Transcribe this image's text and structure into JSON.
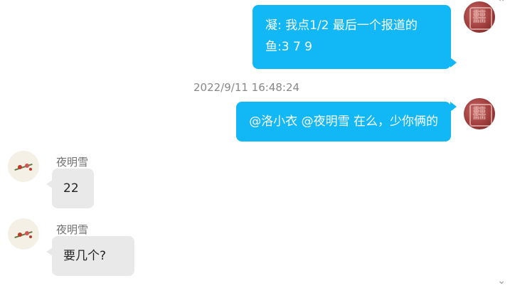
{
  "messages": [
    {
      "side": "out",
      "line1": "凝:  我点1/2  最后一个报道的",
      "line2": "鱼:3 7 9"
    },
    {
      "timestamp": "2022/9/11 16:48:24"
    },
    {
      "side": "out",
      "text": "@洛小衣 @夜明雪 在么，少你俩的"
    },
    {
      "side": "in",
      "sender": "夜明雪",
      "text": "22"
    },
    {
      "side": "in",
      "sender": "夜明雪",
      "text": "要几个?"
    }
  ],
  "icons": {
    "scroll_up": "chevron-up-icon",
    "scroll_down": "chevron-down-icon"
  },
  "colors": {
    "outgoing": "#12b7f5",
    "incoming": "#e9e9e9"
  }
}
